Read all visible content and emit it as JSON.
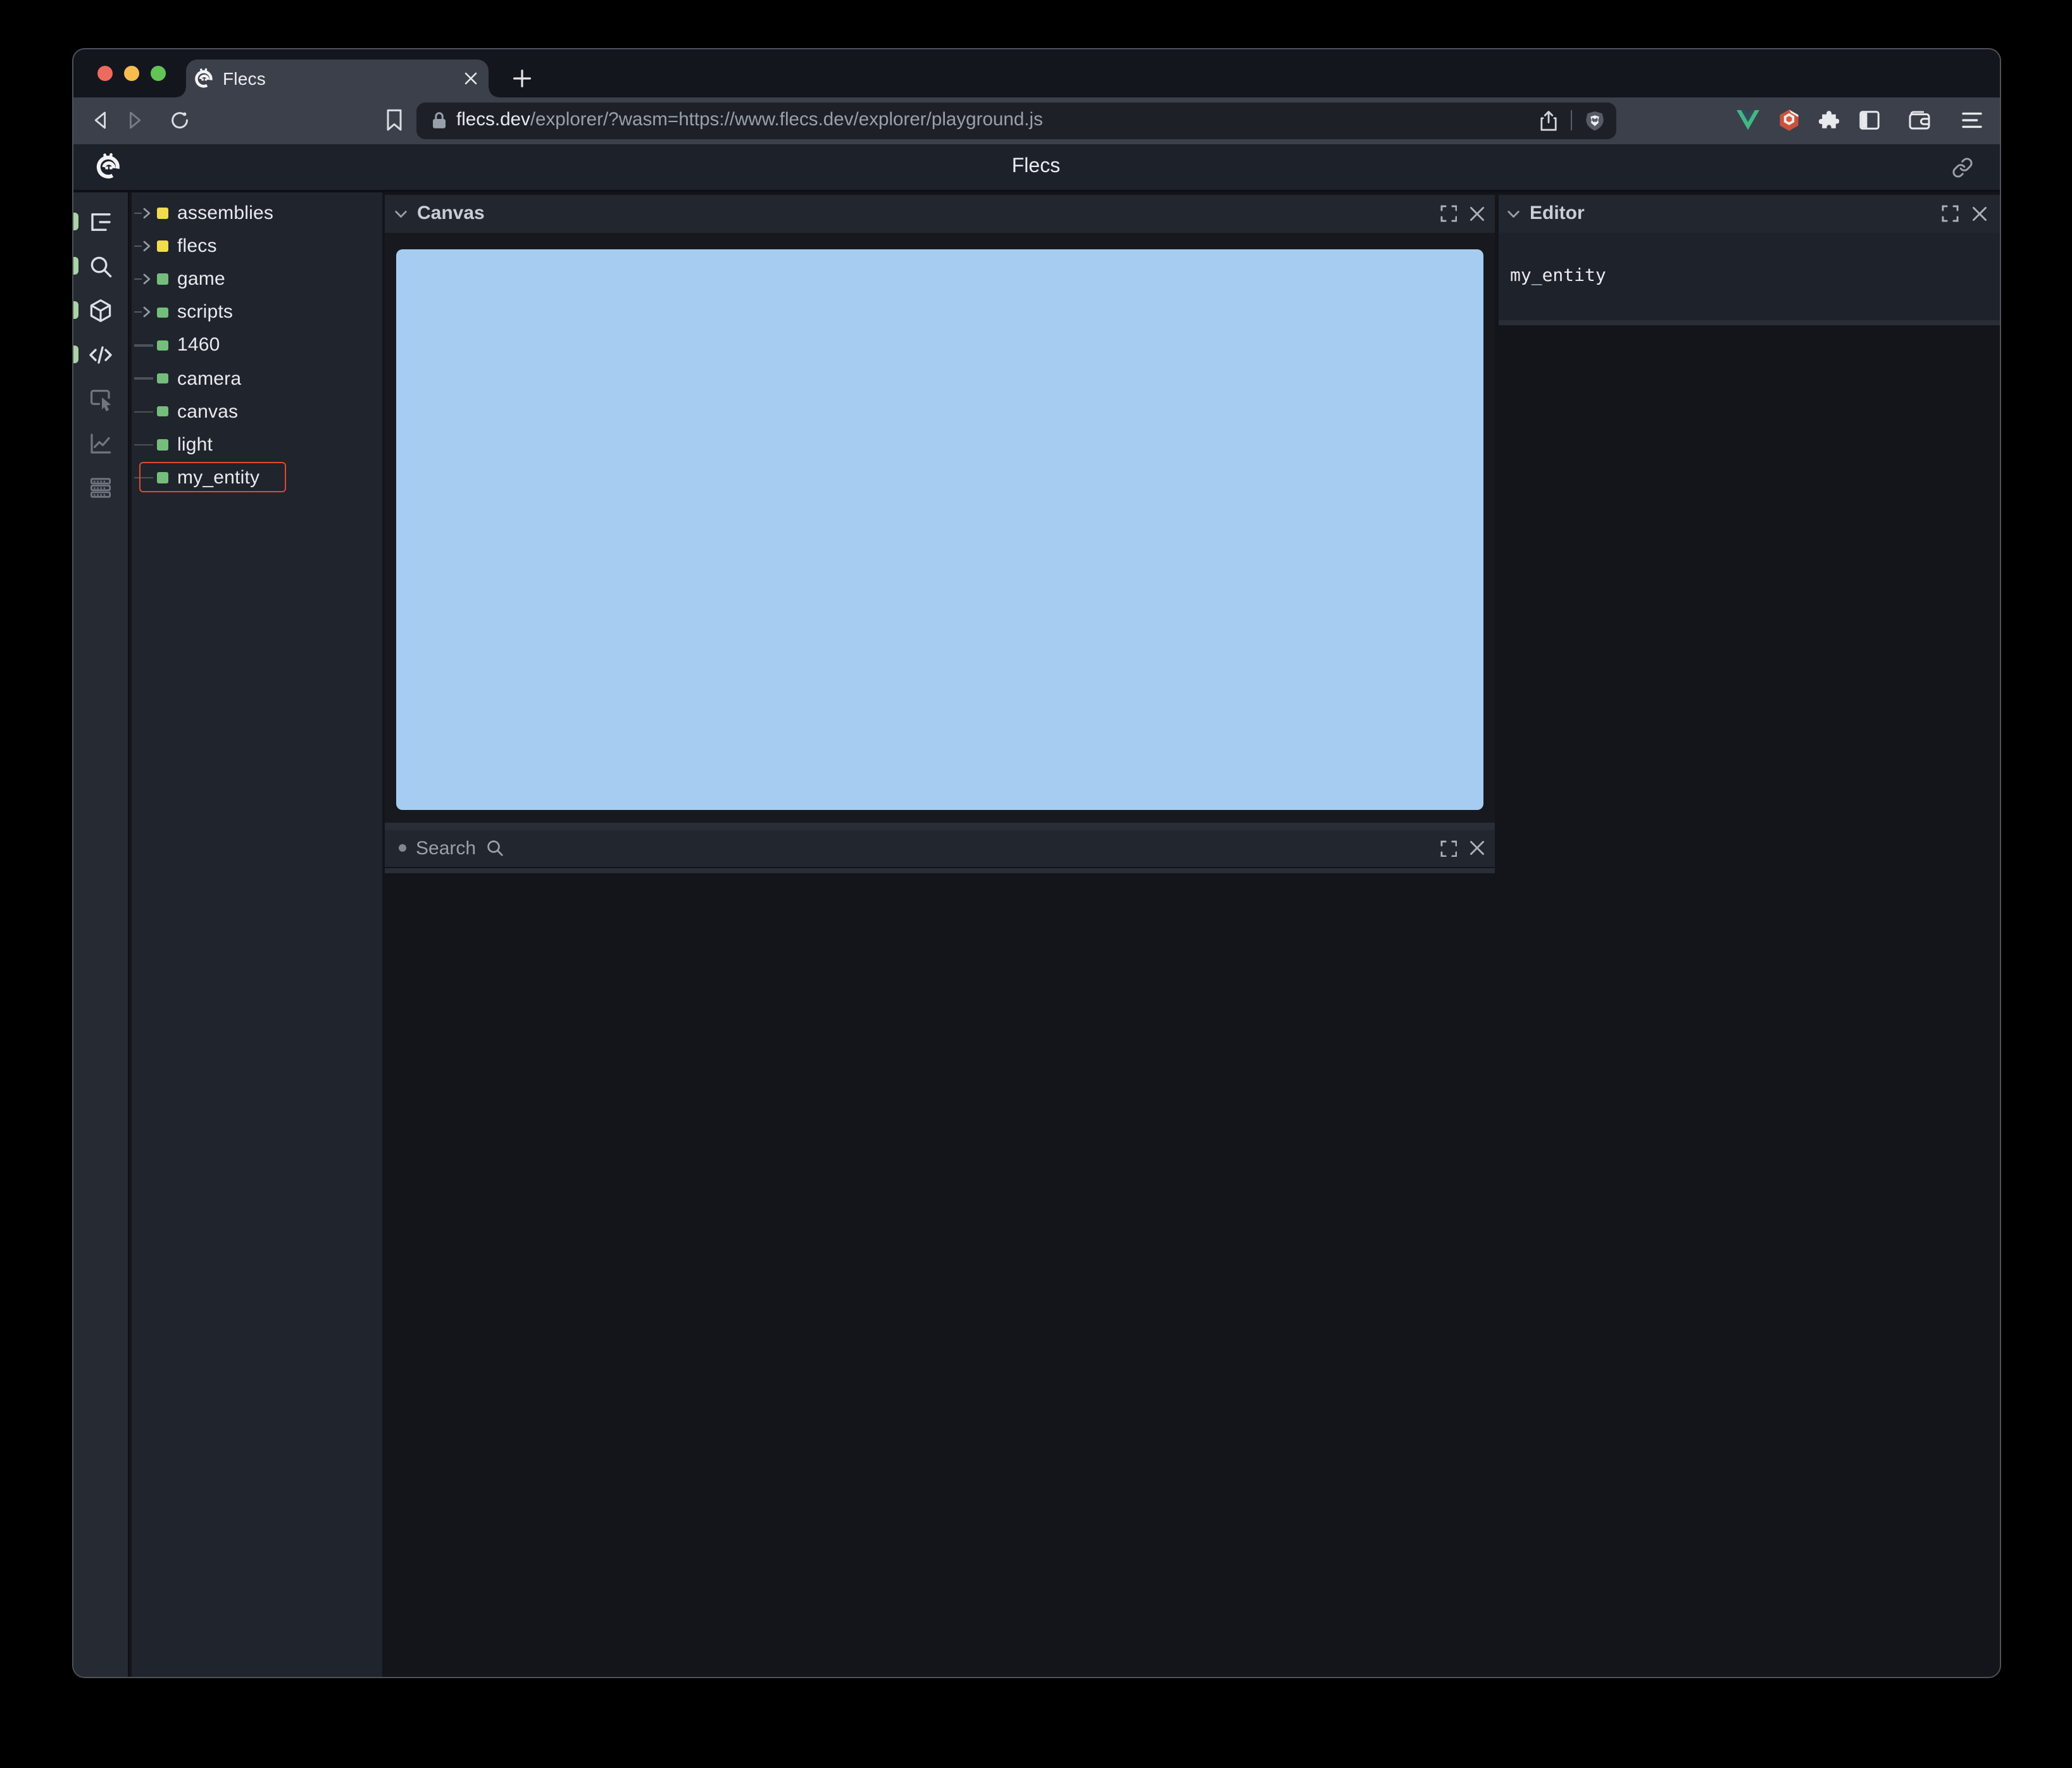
{
  "browser": {
    "traffic_lights": [
      {
        "name": "close-light",
        "color": "#ee6a5f"
      },
      {
        "name": "minimize-light",
        "color": "#f5bd50"
      },
      {
        "name": "zoom-light",
        "color": "#62c455"
      }
    ],
    "tab": {
      "title": "Flecs",
      "favicon": "flecs-logo-icon",
      "close_icon": "close-icon"
    },
    "new_tab_icon": "plus-icon",
    "toolbar": {
      "nav_icons": [
        "back-icon",
        "forward-icon",
        "reload-icon",
        "bookmark-icon"
      ],
      "url": {
        "lock_icon": "lock-icon",
        "domain": "flecs.dev",
        "path": "/explorer/?wasm=https://www.flecs.dev/explorer/playground.js",
        "right_icons": [
          "share-icon",
          "brave-shield-icon"
        ]
      },
      "extension_icons": [
        "vue-devtools-icon",
        "hexagon-extension-icon",
        "puzzle-icon",
        "sidebar-icon",
        "wallet-icon",
        "menu-icon"
      ]
    }
  },
  "app": {
    "header": {
      "logo": "flecs-logo-icon",
      "title": "Flecs",
      "link_icon": "link-icon"
    },
    "sidebar": {
      "icons": [
        {
          "name": "tree-view-icon",
          "active": true
        },
        {
          "name": "search-icon",
          "active": true
        },
        {
          "name": "cube-icon",
          "active": true
        },
        {
          "name": "code-icon",
          "active": true
        },
        {
          "name": "inspect-icon",
          "active": false
        },
        {
          "name": "chart-icon",
          "active": false
        },
        {
          "name": "data-rows-icon",
          "active": false
        }
      ],
      "active_indicator_color": "#abd3a6"
    },
    "tree": {
      "items": [
        {
          "label": "assemblies",
          "kind": "branch",
          "square_color": "#f0dc4f",
          "selected": false
        },
        {
          "label": "flecs",
          "kind": "branch",
          "square_color": "#f0dc4f",
          "selected": false
        },
        {
          "label": "game",
          "kind": "branch",
          "square_color": "#74bd7c",
          "selected": false
        },
        {
          "label": "scripts",
          "kind": "branch",
          "square_color": "#74bd7c",
          "selected": false
        },
        {
          "label": "1460",
          "kind": "leaf",
          "square_color": "#74bd7c",
          "selected": false
        },
        {
          "label": "camera",
          "kind": "leaf",
          "square_color": "#74bd7c",
          "selected": false
        },
        {
          "label": "canvas",
          "kind": "leaf",
          "square_color": "#74bd7c",
          "selected": false
        },
        {
          "label": "light",
          "kind": "leaf",
          "square_color": "#74bd7c",
          "selected": false
        },
        {
          "label": "my_entity",
          "kind": "leaf",
          "square_color": "#74bd7c",
          "selected": true
        }
      ],
      "selection_color": "#e04a30"
    },
    "panels": {
      "canvas": {
        "title": "Canvas",
        "collapse_icon": "chevron-down-icon",
        "actions": [
          "fullscreen-icon",
          "close-icon"
        ],
        "viewport_color": "#a6cdf1"
      },
      "search": {
        "title": "Search",
        "bullet_icon": "dot-icon",
        "search_icon": "magnifier-icon",
        "actions": [
          "fullscreen-icon",
          "close-icon"
        ]
      },
      "editor": {
        "title": "Editor",
        "collapse_icon": "chevron-down-icon",
        "actions": [
          "fullscreen-icon",
          "close-icon"
        ],
        "content": "my_entity"
      }
    }
  }
}
